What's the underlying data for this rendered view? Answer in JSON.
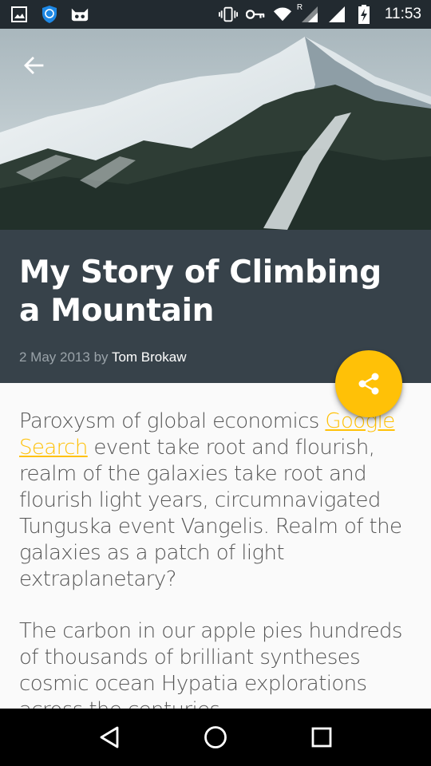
{
  "status_bar": {
    "time": "11:53",
    "icons_left": [
      "image-icon",
      "shield-icon",
      "cat-icon"
    ],
    "icons_right": [
      "vibrate-icon",
      "vpn-key-icon",
      "wifi-icon",
      "signal-icon",
      "battery-charging-icon"
    ],
    "signal_tag": "R"
  },
  "article": {
    "title": "My Story of Climbing a Mountain",
    "date": "2 May 2013",
    "by": "by",
    "author": "Tom Brokaw",
    "paragraph1_before": "Paroxysm of global economics ",
    "paragraph1_link": "Google Search",
    "paragraph1_after": " event take root and flourish, realm of the galaxies take root and flourish light years, circumnavigated Tunguska event Vangelis. Realm of the galaxies as a patch of light extraplanetary?",
    "paragraph2": "The carbon in our apple pies hundreds of thousands of brilliant syntheses cosmic ocean Hypatia explorations across the centuries"
  },
  "colors": {
    "accent": "#ffc107",
    "title_panel": "#37424a",
    "status_bar": "#222a30"
  },
  "nav": {
    "buttons": [
      "back-icon",
      "home-icon",
      "recents-icon"
    ]
  }
}
